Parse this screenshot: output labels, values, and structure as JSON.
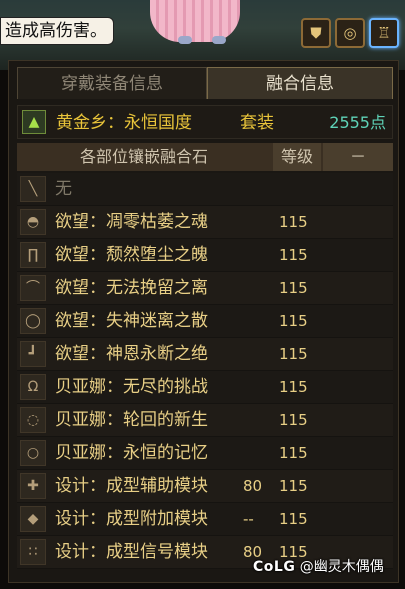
{
  "tooltip": {
    "text": "造成高伤害。"
  },
  "top_buttons": [
    {
      "icon": "armor-icon"
    },
    {
      "icon": "ring-icon"
    },
    {
      "icon": "trophy-icon"
    }
  ],
  "tabs": [
    {
      "label": "穿戴装备信息",
      "active": false
    },
    {
      "label": "融合信息",
      "active": true
    }
  ],
  "set": {
    "name": "黄金乡：永恒国度",
    "type": "套装",
    "points": "2555点"
  },
  "table": {
    "headers": [
      "各部位镶嵌融合石",
      "等级",
      "－"
    ],
    "rows": [
      {
        "icon": "sword-slot-icon",
        "name": "无",
        "extra": "",
        "level": ""
      },
      {
        "icon": "shoulder-slot-icon",
        "name": "欲望：凋零枯萎之魂",
        "extra": "",
        "level": "115"
      },
      {
        "icon": "pants-slot-icon",
        "name": "欲望：颓然堕尘之魄",
        "extra": "",
        "level": "115"
      },
      {
        "icon": "hat-slot-icon",
        "name": "欲望：无法挽留之离",
        "extra": "",
        "level": "115"
      },
      {
        "icon": "belt-slot-icon",
        "name": "欲望：失神迷离之散",
        "extra": "",
        "level": "115"
      },
      {
        "icon": "boots-slot-icon",
        "name": "欲望：神恩永断之绝",
        "extra": "",
        "level": "115"
      },
      {
        "icon": "necklace-slot-icon",
        "name": "贝亚娜：无尽的挑战",
        "extra": "",
        "level": "115"
      },
      {
        "icon": "bracelet-slot-icon",
        "name": "贝亚娜：轮回的新生",
        "extra": "",
        "level": "115"
      },
      {
        "icon": "ring-slot-icon",
        "name": "贝亚娜：永恒的记忆",
        "extra": "",
        "level": "115"
      },
      {
        "icon": "support-slot-icon",
        "name": "设计：成型辅助模块",
        "extra": "80",
        "level": "115"
      },
      {
        "icon": "magic-stone-slot-icon",
        "name": "设计：成型附加模块",
        "extra": "--",
        "level": "115"
      },
      {
        "icon": "earring-slot-icon",
        "name": "设计：成型信号模块",
        "extra": "80",
        "level": "115"
      }
    ]
  },
  "watermark": {
    "brand": "CoLG",
    "user": "@幽灵木偶偶"
  }
}
